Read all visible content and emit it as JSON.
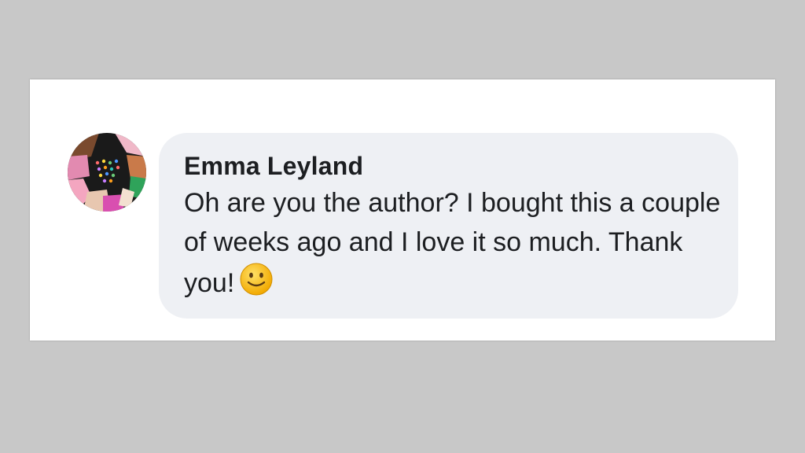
{
  "comment": {
    "author": "Emma Leyland",
    "text": "Oh are you the author? I bought this a couple of weeks ago and I love it so much. Thank you!",
    "emoji": "slightly-smiling-face-icon",
    "avatar": "profile-avatar"
  },
  "colors": {
    "page_background": "#c8c8c8",
    "card_background": "#ffffff",
    "bubble_background": "#eef0f4",
    "text": "#1c1e21",
    "emoji_face": "#f7c02b"
  }
}
